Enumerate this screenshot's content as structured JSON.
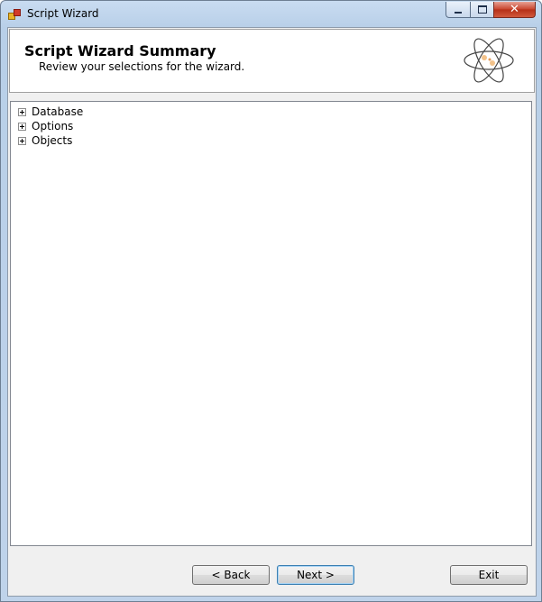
{
  "window": {
    "title": "Script Wizard"
  },
  "header": {
    "title": "Script Wizard Summary",
    "subtitle": "Review your selections for the wizard."
  },
  "tree": {
    "items": [
      {
        "label": "Database"
      },
      {
        "label": "Options"
      },
      {
        "label": "Objects"
      }
    ]
  },
  "buttons": {
    "back": "< Back",
    "next": "Next >",
    "exit": "Exit"
  },
  "icons": {
    "app": "app-icon",
    "header_art": "atom-icon",
    "expander": "plus-expander-icon"
  },
  "colors": {
    "titlebar": "#c9dcf1",
    "close_button": "#c7432c",
    "dialog_bg": "#f0f0f0",
    "default_button_border": "#3c7fb1"
  }
}
